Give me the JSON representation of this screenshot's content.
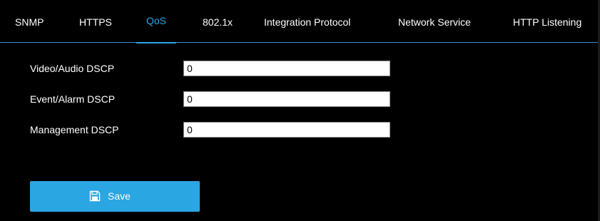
{
  "tabs": [
    {
      "label": "SNMP"
    },
    {
      "label": "HTTPS"
    },
    {
      "label": "QoS"
    },
    {
      "label": "802.1x"
    },
    {
      "label": "Integration Protocol"
    },
    {
      "label": "Network Service"
    },
    {
      "label": "HTTP Listening"
    }
  ],
  "active_tab": "QoS",
  "form": {
    "video_audio_dscp": {
      "label": "Video/Audio DSCP",
      "value": "0"
    },
    "event_alarm_dscp": {
      "label": "Event/Alarm DSCP",
      "value": "0"
    },
    "management_dscp": {
      "label": "Management DSCP",
      "value": "0"
    }
  },
  "save_button": {
    "label": "Save",
    "icon": "floppy-disk-icon"
  },
  "colors": {
    "background": "#000000",
    "accent": "#2aa5e0",
    "button": "#2aa6e2",
    "text": "#ffffff"
  }
}
